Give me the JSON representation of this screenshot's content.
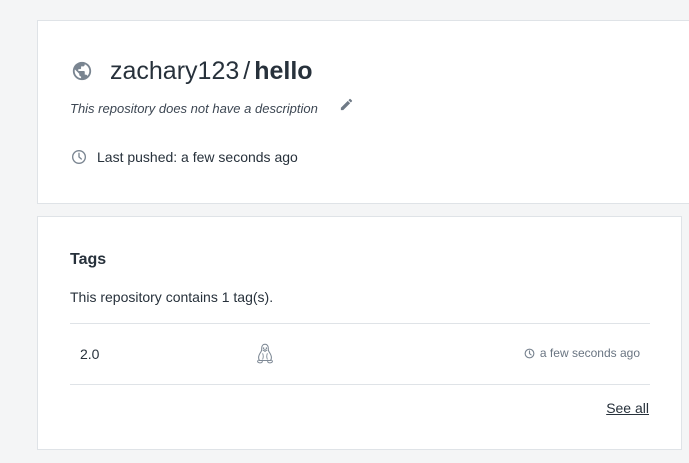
{
  "repo": {
    "owner": "zachary123",
    "separator": "/",
    "name": "hello",
    "description": "This repository does not have a description",
    "last_pushed": "Last pushed: a few seconds ago"
  },
  "tags": {
    "heading": "Tags",
    "count_text": "This repository contains 1 tag(s).",
    "rows": [
      {
        "name": "2.0",
        "os_icon": "linux-icon",
        "time": "a few seconds ago"
      }
    ],
    "see_all_label": "See all"
  },
  "icons": {
    "visibility": "globe-icon",
    "edit": "pencil-icon",
    "pushed": "clock-icon"
  },
  "colors": {
    "page_background": "#f4f5f6",
    "card_background": "#ffffff",
    "border": "#dfe3e7",
    "text": "#27313b",
    "icon_gray": "#7a8591"
  }
}
